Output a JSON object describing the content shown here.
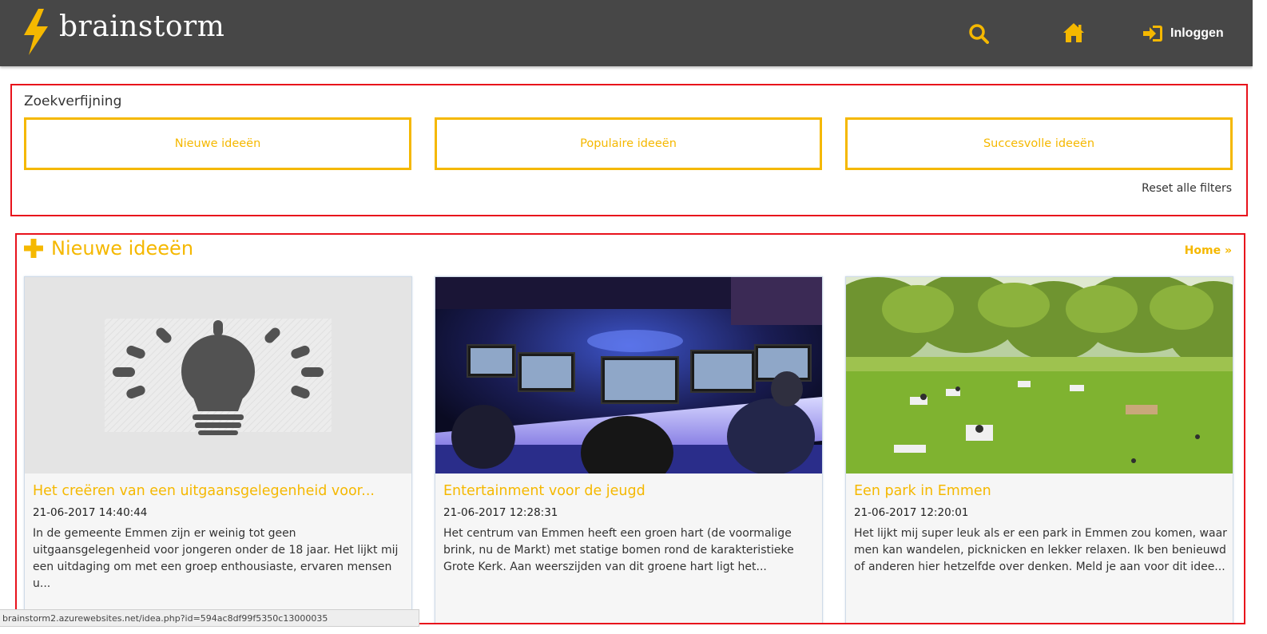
{
  "header": {
    "logo_text": "brainstorm",
    "login_label": "Inloggen",
    "icons": {
      "logo": "lightning-bolt-icon",
      "search": "search-icon",
      "home": "home-icon",
      "login": "sign-in-icon"
    }
  },
  "filters": {
    "title": "Zoekverfijning",
    "buttons": [
      "Nieuwe ideeën",
      "Populaire ideeën",
      "Succesvolle ideeën"
    ],
    "reset_label": "Reset alle filters"
  },
  "ideas": {
    "section_title": "Nieuwe ideeën",
    "home_link": "Home »",
    "cards": [
      {
        "title": "Het creëren van een uitgaansgelegenheid voor...",
        "date": "21-06-2017 14:40:44",
        "description": "In de gemeente Emmen zijn er weinig tot geen uitgaansgelegenheid voor jongeren onder de 18 jaar. Het lijkt mij een uitdaging om met een groep enthousiaste, ervaren mensen u...",
        "image": "lightbulb-placeholder"
      },
      {
        "title": "Entertainment voor de jeugd",
        "date": "21-06-2017 12:28:31",
        "description": "Het centrum van Emmen heeft een groen hart (de voormalige brink, nu de Markt) met statige bomen rond de karakteristieke Grote Kerk. Aan weerszijden van dit groene hart ligt het...",
        "image": "gaming-event-photo"
      },
      {
        "title": "Een park in Emmen",
        "date": "21-06-2017 12:20:01",
        "description": "Het lijkt mij super leuk als er een park in Emmen zou komen, waar men kan wandelen, picknicken en lekker relaxen. Ik ben benieuwd of anderen hier hetzelfde over denken. Meld je aan voor dit idee...",
        "image": "park-photo"
      }
    ]
  },
  "status_bar": {
    "url": "brainstorm2.azurewebsites.net/idea.php?id=594ac8df99f5350c13000035"
  },
  "colors": {
    "accent": "#f5b800",
    "header_bg": "#474747",
    "highlight_border": "#e8121c"
  }
}
